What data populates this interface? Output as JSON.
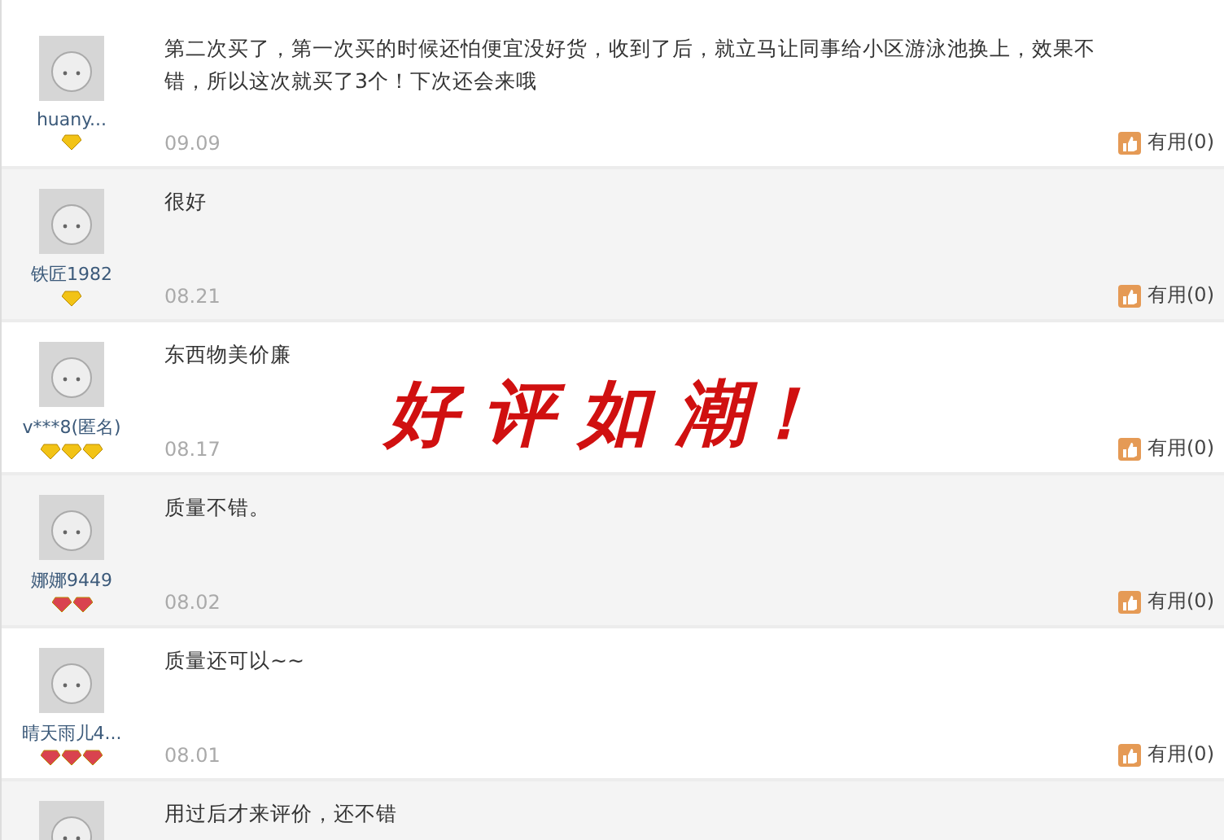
{
  "reviews": [
    {
      "user": "huany...",
      "rank_icons": [
        {
          "kind": "diamond"
        }
      ],
      "text": "第二次买了，第一次买的时候还怕便宜没好货，收到了后，就立马让同事给小区游泳池换上，效果不错，所以这次就买了3个！下次还会来哦",
      "date": "09.09",
      "useful": "有用(0)"
    },
    {
      "user": "铁匠1982",
      "rank_icons": [
        {
          "kind": "diamond"
        }
      ],
      "text": "很好",
      "date": "08.21",
      "useful": "有用(0)"
    },
    {
      "user": "v***8(匿名)",
      "rank_icons": [
        {
          "kind": "diamond"
        },
        {
          "kind": "diamond"
        },
        {
          "kind": "diamond"
        }
      ],
      "text": "东西物美价廉",
      "date": "08.17",
      "useful": "有用(0)"
    },
    {
      "user": "娜娜9449",
      "rank_icons": [
        {
          "kind": "heart"
        },
        {
          "kind": "heart"
        }
      ],
      "text": "质量不错。",
      "date": "08.02",
      "useful": "有用(0)"
    },
    {
      "user": "晴天雨儿4...",
      "rank_icons": [
        {
          "kind": "heart"
        },
        {
          "kind": "heart"
        },
        {
          "kind": "heart"
        }
      ],
      "text": "质量还可以~~",
      "date": "08.01",
      "useful": "有用(0)"
    },
    {
      "text": "用过后才来评价，还不错"
    }
  ],
  "overlay": "好 评 如 潮！"
}
